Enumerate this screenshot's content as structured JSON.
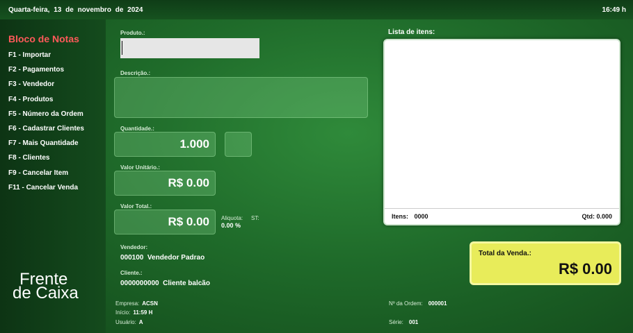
{
  "header": {
    "date": "Quarta-feira, 13 de novembro de 2024",
    "time": "16:49 h"
  },
  "sidebar": {
    "title": "Bloco de Notas",
    "items": [
      "F1 - Importar",
      "F2 - Pagamentos",
      "F3 - Vendedor",
      "F4 - Produtos",
      "F5 - Número da Ordem",
      "F6 - Cadastrar Clientes",
      "F7 - Mais Quantidade",
      "F8 - Clientes",
      "F9 - Cancelar Item",
      "F11 - Cancelar Venda"
    ],
    "logo_line1": "Frente",
    "logo_line2": "de Caixa"
  },
  "form": {
    "produto_label": "Produto.:",
    "produto_value": "",
    "descricao_label": "Descrição.:",
    "quantidade_label": "Quantidade.:",
    "quantidade_value": "1.000",
    "valor_unitario_label": "Valor Unitário.:",
    "valor_unitario_value": "R$ 0.00",
    "valor_total_label": "Valor Total.:",
    "valor_total_value": "R$ 0.00",
    "aliquota_label": "Aliquota:",
    "aliquota_value": "0.00 %",
    "st_label": "ST:",
    "vendedor_label": "Vendedor:",
    "vendedor_value": "000100  Vendedor Padrao",
    "cliente_label": "Cliente.:",
    "cliente_value": "0000000000  Cliente balcão"
  },
  "list": {
    "title": "Lista de itens:",
    "itens_label": "Itens:",
    "itens_value": "0000",
    "qtd_label": "Qtd:",
    "qtd_value": "0.000"
  },
  "total": {
    "label": "Total da Venda.:",
    "value": "R$ 0.00"
  },
  "footer": {
    "empresa_label": "Empresa:",
    "empresa_value": "ACSN",
    "inicio_label": "Início:",
    "inicio_value": "11:59 H",
    "usuario_label": "Usuário:",
    "usuario_value": "A",
    "ordem_label": "Nº da Ordem:",
    "ordem_value": "000001",
    "serie_label": "Série:",
    "serie_value": "001"
  }
}
